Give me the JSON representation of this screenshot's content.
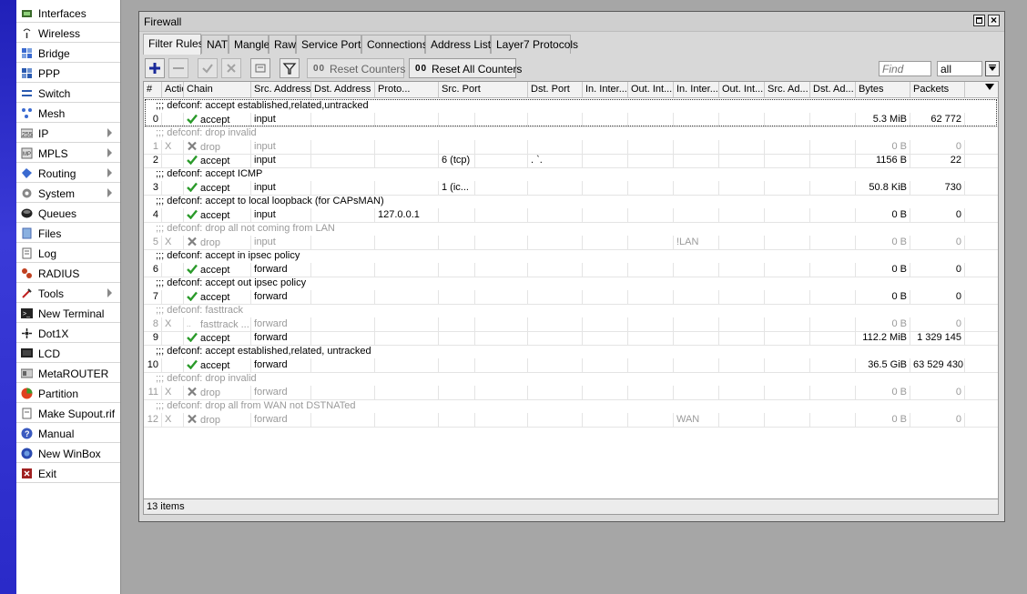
{
  "sidebar": {
    "items": [
      {
        "label": "Interfaces",
        "icon": "interfaces-icon",
        "submenu": false
      },
      {
        "label": "Wireless",
        "icon": "wireless-icon",
        "submenu": false
      },
      {
        "label": "Bridge",
        "icon": "bridge-icon",
        "submenu": false
      },
      {
        "label": "PPP",
        "icon": "ppp-icon",
        "submenu": false
      },
      {
        "label": "Switch",
        "icon": "switch-icon",
        "submenu": false
      },
      {
        "label": "Mesh",
        "icon": "mesh-icon",
        "submenu": false
      },
      {
        "label": "IP",
        "icon": "ip-icon",
        "submenu": true
      },
      {
        "label": "MPLS",
        "icon": "mpls-icon",
        "submenu": true
      },
      {
        "label": "Routing",
        "icon": "routing-icon",
        "submenu": true
      },
      {
        "label": "System",
        "icon": "system-gear-icon",
        "submenu": true
      },
      {
        "label": "Queues",
        "icon": "queues-icon",
        "submenu": false
      },
      {
        "label": "Files",
        "icon": "files-icon",
        "submenu": false
      },
      {
        "label": "Log",
        "icon": "log-icon",
        "submenu": false
      },
      {
        "label": "RADIUS",
        "icon": "radius-icon",
        "submenu": false
      },
      {
        "label": "Tools",
        "icon": "tools-icon",
        "submenu": true
      },
      {
        "label": "New Terminal",
        "icon": "terminal-icon",
        "submenu": false
      },
      {
        "label": "Dot1X",
        "icon": "dot1x-icon",
        "submenu": false
      },
      {
        "label": "LCD",
        "icon": "lcd-icon",
        "submenu": false
      },
      {
        "label": "MetaROUTER",
        "icon": "metarouter-icon",
        "submenu": false
      },
      {
        "label": "Partition",
        "icon": "partition-icon",
        "submenu": false
      },
      {
        "label": "Make Supout.rif",
        "icon": "supout-icon",
        "submenu": false
      },
      {
        "label": "Manual",
        "icon": "manual-help-icon",
        "submenu": false
      },
      {
        "label": "New WinBox",
        "icon": "winbox-icon",
        "submenu": false
      },
      {
        "label": "Exit",
        "icon": "exit-icon",
        "submenu": false
      }
    ]
  },
  "window": {
    "title": "Firewall",
    "maximize_icon": "maximize-icon",
    "close_label": "×"
  },
  "tabs": [
    {
      "label": "Filter Rules",
      "active": true
    },
    {
      "label": "NAT",
      "active": false
    },
    {
      "label": "Mangle",
      "active": false
    },
    {
      "label": "Raw",
      "active": false
    },
    {
      "label": "Service Ports",
      "active": false
    },
    {
      "label": "Connections",
      "active": false
    },
    {
      "label": "Address Lists",
      "active": false
    },
    {
      "label": "Layer7 Protocols",
      "active": false
    }
  ],
  "toolbar": {
    "add_icon": "plus-icon",
    "remove_icon": "minus-icon",
    "enable_icon": "check-icon",
    "disable_icon": "x-icon",
    "comment_icon": "comment-icon",
    "filter_icon": "funnel-icon",
    "reset_counters_label": "Reset Counters",
    "reset_all_counters_label": "Reset All Counters",
    "counter_prefix": "00",
    "find_placeholder": "Find",
    "filter_value": "all"
  },
  "table": {
    "columns": [
      "#",
      "Action",
      "Chain",
      "Src. Address",
      "Dst. Address",
      "Proto...",
      "Src. Port",
      "Dst. Port",
      "In. Inter...",
      "Out. Int...",
      "In. Inter...",
      "Out. Int...",
      "Src. Ad...",
      "Dst. Ad...",
      "Bytes",
      "Packets"
    ],
    "rows": [
      {
        "type": "comment",
        "text": ";;; defconf: accept established,related,untracked",
        "disabled": false
      },
      {
        "type": "rule",
        "num": "0",
        "flag": "",
        "action": "accept",
        "chain": "input",
        "src": "",
        "dst": "",
        "proto": "",
        "sport": "",
        "dport": "",
        "in_if": "",
        "out_if": "",
        "in_list": "",
        "out_list": "",
        "src_list": "",
        "dst_list": "",
        "bytes": "5.3 MiB",
        "packets": "62 772",
        "disabled": false
      },
      {
        "type": "comment",
        "text": ";;; defconf: drop invalid",
        "disabled": true
      },
      {
        "type": "rule",
        "num": "1",
        "flag": "X",
        "action": "drop",
        "chain": "input",
        "src": "",
        "dst": "",
        "proto": "",
        "sport": "",
        "dport": "",
        "in_if": "",
        "out_if": "",
        "in_list": "",
        "out_list": "",
        "src_list": "",
        "dst_list": "",
        "bytes": "0 B",
        "packets": "0",
        "disabled": true
      },
      {
        "type": "rule",
        "num": "2",
        "flag": "",
        "action": "accept",
        "chain": "input",
        "src": "",
        "dst": "",
        "proto": "6 (tcp)",
        "sport": "",
        "dport": ".  `.",
        "in_if": "",
        "out_if": "",
        "in_list": "",
        "out_list": "",
        "src_list": "",
        "dst_list": "",
        "bytes": "1156 B",
        "packets": "22",
        "disabled": false
      },
      {
        "type": "comment",
        "text": ";;; defconf: accept ICMP",
        "disabled": false
      },
      {
        "type": "rule",
        "num": "3",
        "flag": "",
        "action": "accept",
        "chain": "input",
        "src": "",
        "dst": "",
        "proto": "1 (ic...",
        "sport": "",
        "dport": "",
        "in_if": "",
        "out_if": "",
        "in_list": "",
        "out_list": "",
        "src_list": "",
        "dst_list": "",
        "bytes": "50.8 KiB",
        "packets": "730",
        "disabled": false
      },
      {
        "type": "comment",
        "text": ";;; defconf: accept to local loopback (for CAPsMAN)",
        "disabled": false
      },
      {
        "type": "rule",
        "num": "4",
        "flag": "",
        "action": "accept",
        "chain": "input",
        "src": "",
        "dst": "127.0.0.1",
        "proto": "",
        "sport": "",
        "dport": "",
        "in_if": "",
        "out_if": "",
        "in_list": "",
        "out_list": "",
        "src_list": "",
        "dst_list": "",
        "bytes": "0 B",
        "packets": "0",
        "disabled": false
      },
      {
        "type": "comment",
        "text": ";;; defconf: drop all not coming from LAN",
        "disabled": true
      },
      {
        "type": "rule",
        "num": "5",
        "flag": "X",
        "action": "drop",
        "chain": "input",
        "src": "",
        "dst": "",
        "proto": "",
        "sport": "",
        "dport": "",
        "in_if": "",
        "out_if": "",
        "in_list": "!LAN",
        "out_list": "",
        "src_list": "",
        "dst_list": "",
        "bytes": "0 B",
        "packets": "0",
        "disabled": true
      },
      {
        "type": "comment",
        "text": ";;; defconf: accept in ipsec policy",
        "disabled": false
      },
      {
        "type": "rule",
        "num": "6",
        "flag": "",
        "action": "accept",
        "chain": "forward",
        "src": "",
        "dst": "",
        "proto": "",
        "sport": "",
        "dport": "",
        "in_if": "",
        "out_if": "",
        "in_list": "",
        "out_list": "",
        "src_list": "",
        "dst_list": "",
        "bytes": "0 B",
        "packets": "0",
        "disabled": false
      },
      {
        "type": "comment",
        "text": ";;; defconf: accept out ipsec policy",
        "disabled": false
      },
      {
        "type": "rule",
        "num": "7",
        "flag": "",
        "action": "accept",
        "chain": "forward",
        "src": "",
        "dst": "",
        "proto": "",
        "sport": "",
        "dport": "",
        "in_if": "",
        "out_if": "",
        "in_list": "",
        "out_list": "",
        "src_list": "",
        "dst_list": "",
        "bytes": "0 B",
        "packets": "0",
        "disabled": false
      },
      {
        "type": "comment",
        "text": ";;; defconf: fasttrack",
        "disabled": true
      },
      {
        "type": "rule",
        "num": "8",
        "flag": "X",
        "action": "fasttrack ...",
        "chain": "forward",
        "src": "",
        "dst": "",
        "proto": "",
        "sport": "",
        "dport": "",
        "in_if": "",
        "out_if": "",
        "in_list": "",
        "out_list": "",
        "src_list": "",
        "dst_list": "",
        "bytes": "0 B",
        "packets": "0",
        "disabled": true
      },
      {
        "type": "rule",
        "num": "9",
        "flag": "",
        "action": "accept",
        "chain": "forward",
        "src": "",
        "dst": "",
        "proto": "",
        "sport": "",
        "dport": "",
        "in_if": "",
        "out_if": "",
        "in_list": "",
        "out_list": "",
        "src_list": "",
        "dst_list": "",
        "bytes": "112.2 MiB",
        "packets": "1 329 145",
        "disabled": false
      },
      {
        "type": "comment",
        "text": ";;; defconf: accept established,related, untracked",
        "disabled": false
      },
      {
        "type": "rule",
        "num": "10",
        "flag": "",
        "action": "accept",
        "chain": "forward",
        "src": "",
        "dst": "",
        "proto": "",
        "sport": "",
        "dport": "",
        "in_if": "",
        "out_if": "",
        "in_list": "",
        "out_list": "",
        "src_list": "",
        "dst_list": "",
        "bytes": "36.5 GiB",
        "packets": "63 529 430",
        "disabled": false
      },
      {
        "type": "comment",
        "text": ";;; defconf: drop invalid",
        "disabled": true
      },
      {
        "type": "rule",
        "num": "11",
        "flag": "X",
        "action": "drop",
        "chain": "forward",
        "src": "",
        "dst": "",
        "proto": "",
        "sport": "",
        "dport": "",
        "in_if": "",
        "out_if": "",
        "in_list": "",
        "out_list": "",
        "src_list": "",
        "dst_list": "",
        "bytes": "0 B",
        "packets": "0",
        "disabled": true
      },
      {
        "type": "comment",
        "text": ";;; defconf: drop all from WAN not DSTNATed",
        "disabled": true
      },
      {
        "type": "rule",
        "num": "12",
        "flag": "X",
        "action": "drop",
        "chain": "forward",
        "src": "",
        "dst": "",
        "proto": "",
        "sport": "",
        "dport": "",
        "in_if": "",
        "out_if": "",
        "in_list": "WAN",
        "out_list": "",
        "src_list": "",
        "dst_list": "",
        "bytes": "0 B",
        "packets": "0",
        "disabled": true
      }
    ]
  },
  "status": {
    "items_count": "13 items"
  },
  "colors": {
    "accept_check": "#2a9a2a",
    "drop_x": "#808080",
    "add_plus": "#1a2a9a",
    "stripe": "#2a2ac8"
  }
}
